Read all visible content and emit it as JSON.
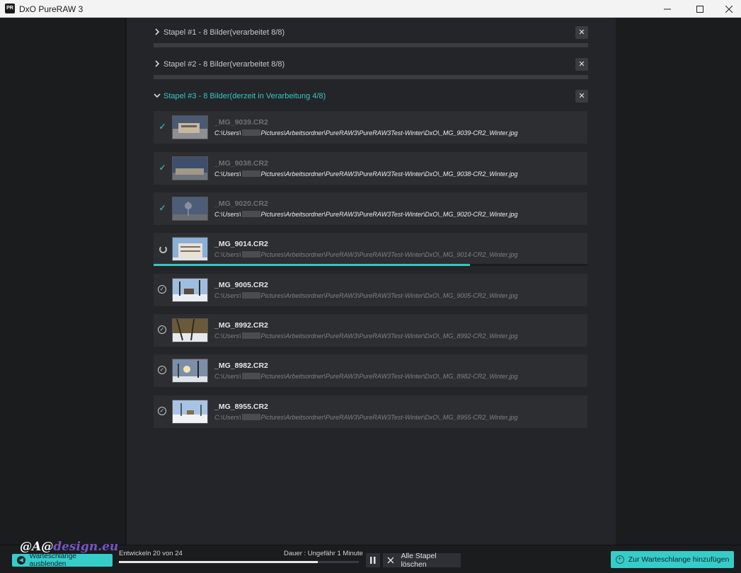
{
  "window": {
    "title": "DxO PureRAW 3",
    "logo": "PR"
  },
  "colors": {
    "accent": "#35c7c4",
    "done_check": "#3ea39a",
    "panel": "#2d2e32"
  },
  "batches": [
    {
      "title": "Stapel #1 - 8 Bilder(verarbeitet 8/8)",
      "chevron": "chevron-right-icon",
      "close": "✕"
    },
    {
      "title": "Stapel #2 - 8 Bilder(verarbeitet 8/8)",
      "chevron": "chevron-right-icon",
      "close": "✕"
    },
    {
      "title": "Stapel #3 - 8 Bilder(derzeit in Verarbeitung 4/8)",
      "chevron": "chevron-down-icon",
      "close": "✕"
    }
  ],
  "files": [
    {
      "name": "_MG_9039.CR2",
      "path_a": "C:\\Users\\",
      "path_b": "Pictures\\Arbeitsordner\\PureRAW3\\PureRAW3Test-Winter\\DxO\\_MG_9039-CR2_Winter.jpg",
      "status": "done",
      "status_icon": "check-icon"
    },
    {
      "name": "_MG_9038.CR2",
      "path_a": "C:\\Users\\",
      "path_b": "Pictures\\Arbeitsordner\\PureRAW3\\PureRAW3Test-Winter\\DxO\\_MG_9038-CR2_Winter.jpg",
      "status": "done",
      "status_icon": "check-icon"
    },
    {
      "name": "_MG_9020.CR2",
      "path_a": "C:\\Users\\",
      "path_b": "Pictures\\Arbeitsordner\\PureRAW3\\PureRAW3Test-Winter\\DxO\\_MG_9020-CR2_Winter.jpg",
      "status": "done",
      "status_icon": "check-icon"
    },
    {
      "name": "_MG_9014.CR2",
      "path_a": "C:\\Users\\",
      "path_b": "Pictures\\Arbeitsordner\\PureRAW3\\PureRAW3Test-Winter\\DxO\\_MG_9014-CR2_Winter.jpg",
      "status": "processing",
      "status_icon": "spinner-icon",
      "progress": 0.73
    },
    {
      "name": "_MG_9005.CR2",
      "path_a": "C:\\Users\\",
      "path_b": "Pictures\\Arbeitsordner\\PureRAW3\\PureRAW3Test-Winter\\DxO\\_MG_9005-CR2_Winter.jpg",
      "status": "pending",
      "status_icon": "pending-icon"
    },
    {
      "name": "_MG_8992.CR2",
      "path_a": "C:\\Users\\",
      "path_b": "Pictures\\Arbeitsordner\\PureRAW3\\PureRAW3Test-Winter\\DxO\\_MG_8992-CR2_Winter.jpg",
      "status": "pending",
      "status_icon": "pending-icon"
    },
    {
      "name": "_MG_8982.CR2",
      "path_a": "C:\\Users\\",
      "path_b": "Pictures\\Arbeitsordner\\PureRAW3\\PureRAW3Test-Winter\\DxO\\_MG_8982-CR2_Winter.jpg",
      "status": "pending",
      "status_icon": "pending-icon"
    },
    {
      "name": "_MG_8955.CR2",
      "path_a": "C:\\Users\\",
      "path_b": "Pictures\\Arbeitsordner\\PureRAW3\\PureRAW3Test-Winter\\DxO\\_MG_8955-CR2_Winter.jpg",
      "status": "pending",
      "status_icon": "pending-icon"
    }
  ],
  "bottom": {
    "watermark_a": "@A@",
    "watermark_b": "design.eu",
    "hide_queue_label": "Warteschlange ausblenden",
    "develop_label": "Entwickeln 20 von 24",
    "develop_progress": 0.83,
    "duration_label": "Dauer : Ungefähr 1 Minute",
    "clear_all_label": "Alle Stapel löschen",
    "add_queue_label": "Zur Warteschlange hinzufügen"
  }
}
